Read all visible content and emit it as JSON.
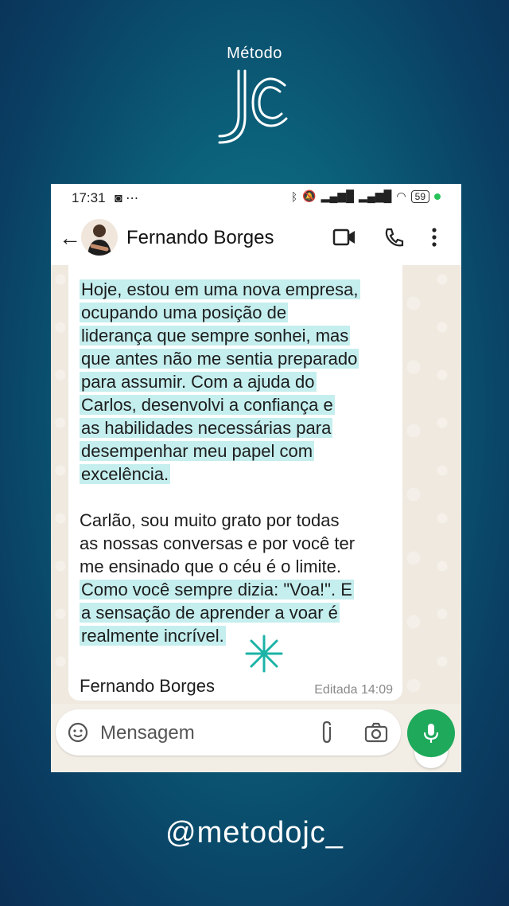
{
  "brand": {
    "top_text": "Método",
    "logo_text": "JC"
  },
  "status_bar": {
    "time": "17:31",
    "battery": "59"
  },
  "header": {
    "contact_name": "Fernando Borges"
  },
  "message": {
    "paragraph1": [
      "Hoje, estou em uma nova empresa,",
      "ocupando uma posição de",
      "liderança que sempre sonhei, mas",
      "que antes não me sentia preparado",
      "para assumir. Com a ajuda do",
      "Carlos, desenvolvi a confiança e",
      "as habilidades necessárias para",
      "desempenhar meu papel com",
      "excelência."
    ],
    "paragraph2": [
      "Carlão, sou muito grato por todas",
      "as nossas conversas e por você ter",
      "me ensinado que o céu é o limite."
    ],
    "paragraph3": [
      "Como você sempre dizia: \"Voa!\". E",
      "a sensação de aprender a voar é",
      "realmente incrível."
    ],
    "signature": "Fernando Borges",
    "edited_label": "Editada 14:09"
  },
  "composer": {
    "placeholder": "Mensagem"
  },
  "footer": {
    "handle": "@metodojc_"
  },
  "colors": {
    "highlight": "#c5eeee",
    "accent": "#1ea95b",
    "spark": "#1bb3a6"
  }
}
